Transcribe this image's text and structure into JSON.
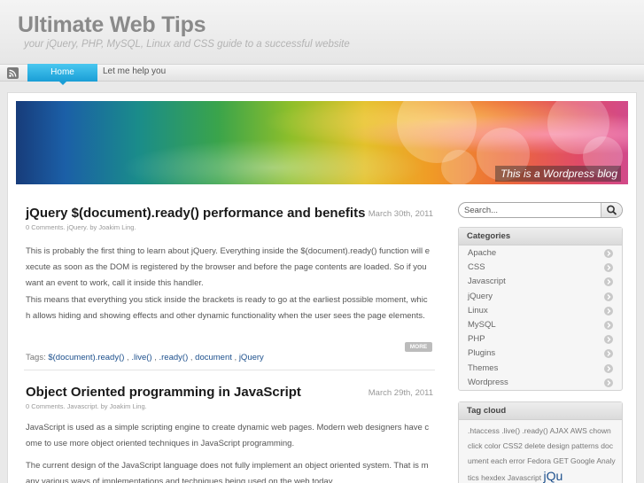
{
  "site": {
    "title": "Ultimate Web Tips",
    "tagline": "your jQuery, PHP, MySQL, Linux and CSS guide to a successful website"
  },
  "nav": {
    "rss_icon": "rss-icon",
    "items": [
      {
        "label": "Home",
        "active": true
      },
      {
        "label": "Let me help you",
        "active": false
      }
    ]
  },
  "banner": {
    "caption": "This is a Wordpress blog"
  },
  "posts": [
    {
      "title": "jQuery $(document).ready() performance and benefits",
      "date": "March 30th, 2011",
      "meta": "0 Comments. jQuery. by Joakim Ling.",
      "paragraphs": [
        "This is probably the first thing to learn about jQuery. Everything inside the $(document).ready() function will execute as soon as the DOM is registered by the browser and before the page contents are loaded. So if you want an event to work, call it inside this handler.",
        "This means that everything you stick inside the brackets is ready to go at the earliest possible moment, which allows hiding and showing effects and other dynamic functionality when the user sees the page elements."
      ],
      "more_label": "MORE",
      "tags_label": "Tags:",
      "tags": [
        "$(document).ready()",
        ".live()",
        ".ready()",
        "document",
        "jQuery"
      ]
    },
    {
      "title": "Object Oriented programming in JavaScript",
      "date": "March 29th, 2011",
      "meta": "0 Comments. Javascript. by Joakim Ling.",
      "paragraphs": [
        "JavaScript is used as a simple scripting engine to create dynamic web pages. Modern web designers have come to use more object oriented techniques in JavaScript programming.",
        "The current design of the JavaScript language does not fully implement an object oriented system. That is many various ways of implementations and techniques being used on the web today."
      ]
    }
  ],
  "sidebar": {
    "search_placeholder": "Search...",
    "categories_title": "Categories",
    "categories": [
      "Apache",
      "CSS",
      "Javascript",
      "jQuery",
      "Linux",
      "MySQL",
      "PHP",
      "Plugins",
      "Themes",
      "Wordpress"
    ],
    "tagcloud_title": "Tag cloud",
    "tagcloud_small": ".htaccess .live() .ready() AJAX AWS chown click color CSS2 delete design patterns document each error Fedora GET Google Analytics hexdex Javascript",
    "tagcloud_big": "jQu"
  }
}
